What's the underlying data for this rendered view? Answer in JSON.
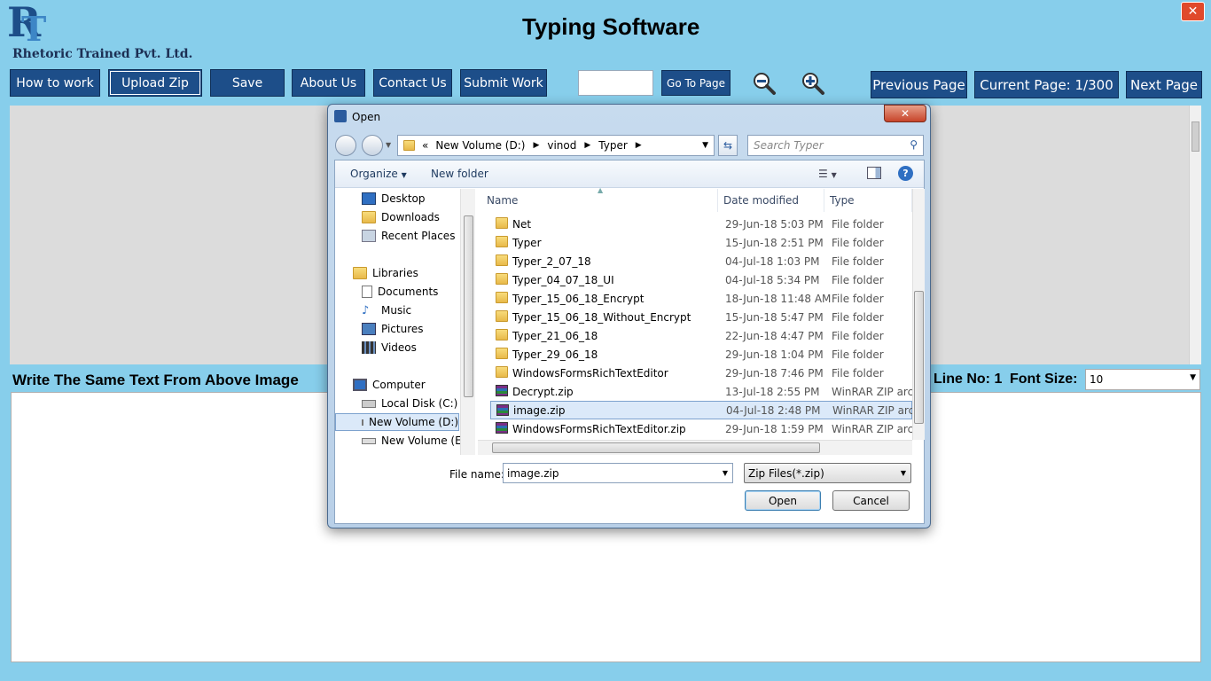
{
  "app": {
    "logo_letters": "RT",
    "company": "Rhetoric Trained Pvt. Ltd.",
    "title": "Typing Software",
    "close_glyph": "✕"
  },
  "toolbar": {
    "how_to_work": "How to work",
    "upload_zip": "Upload Zip",
    "save": "Save",
    "about_us": "About Us",
    "contact_us": "Contact Us",
    "submit_work": "Submit Work",
    "goto_page_value": "",
    "go_to_page": "Go To Page",
    "previous_page": "Previous Page",
    "current_page": "Current Page: 1/300",
    "next_page": "Next Page"
  },
  "editor": {
    "instruction": "Write The Same Text From Above Image",
    "line_no": "Line No: 1",
    "font_size_label": "Font Size:",
    "font_size_value": "10"
  },
  "dialog": {
    "title": "Open",
    "breadcrumb": [
      "«",
      "New Volume (D:)",
      "vinod",
      "Typer"
    ],
    "search_placeholder": "Search Typer",
    "organize": "Organize",
    "new_folder": "New folder",
    "nav": {
      "favorites": [
        "Desktop",
        "Downloads",
        "Recent Places"
      ],
      "libraries_label": "Libraries",
      "libraries": [
        "Documents",
        "Music",
        "Pictures",
        "Videos"
      ],
      "computer_label": "Computer",
      "drives": [
        "Local Disk (C:)",
        "New Volume (D:)",
        "New Volume (E:)"
      ]
    },
    "columns": {
      "name": "Name",
      "date": "Date modified",
      "type": "Type"
    },
    "files": [
      {
        "name": "Net",
        "date": "29-Jun-18 5:03 PM",
        "type": "File folder",
        "kind": "folder"
      },
      {
        "name": "Typer",
        "date": "15-Jun-18 2:51 PM",
        "type": "File folder",
        "kind": "folder"
      },
      {
        "name": "Typer_2_07_18",
        "date": "04-Jul-18 1:03 PM",
        "type": "File folder",
        "kind": "folder"
      },
      {
        "name": "Typer_04_07_18_UI",
        "date": "04-Jul-18 5:34 PM",
        "type": "File folder",
        "kind": "folder"
      },
      {
        "name": "Typer_15_06_18_Encrypt",
        "date": "18-Jun-18 11:48 AM",
        "type": "File folder",
        "kind": "folder"
      },
      {
        "name": "Typer_15_06_18_Without_Encrypt",
        "date": "15-Jun-18 5:47 PM",
        "type": "File folder",
        "kind": "folder"
      },
      {
        "name": "Typer_21_06_18",
        "date": "22-Jun-18 4:47 PM",
        "type": "File folder",
        "kind": "folder"
      },
      {
        "name": "Typer_29_06_18",
        "date": "29-Jun-18 1:04 PM",
        "type": "File folder",
        "kind": "folder"
      },
      {
        "name": "WindowsFormsRichTextEditor",
        "date": "29-Jun-18 7:46 PM",
        "type": "File folder",
        "kind": "folder"
      },
      {
        "name": "Decrypt.zip",
        "date": "13-Jul-18 2:55 PM",
        "type": "WinRAR ZIP archi",
        "kind": "zip"
      },
      {
        "name": "image.zip",
        "date": "04-Jul-18 2:48 PM",
        "type": "WinRAR ZIP archi",
        "kind": "zip",
        "selected": true
      },
      {
        "name": "WindowsFormsRichTextEditor.zip",
        "date": "29-Jun-18 1:59 PM",
        "type": "WinRAR ZIP archi",
        "kind": "zip"
      }
    ],
    "file_name_label": "File name:",
    "file_name_value": "image.zip",
    "filter_value": "Zip Files(*.zip)",
    "open": "Open",
    "cancel": "Cancel"
  },
  "colors": {
    "background": "#87ceeb",
    "button": "#1d4e89",
    "close": "#e04a2b"
  }
}
